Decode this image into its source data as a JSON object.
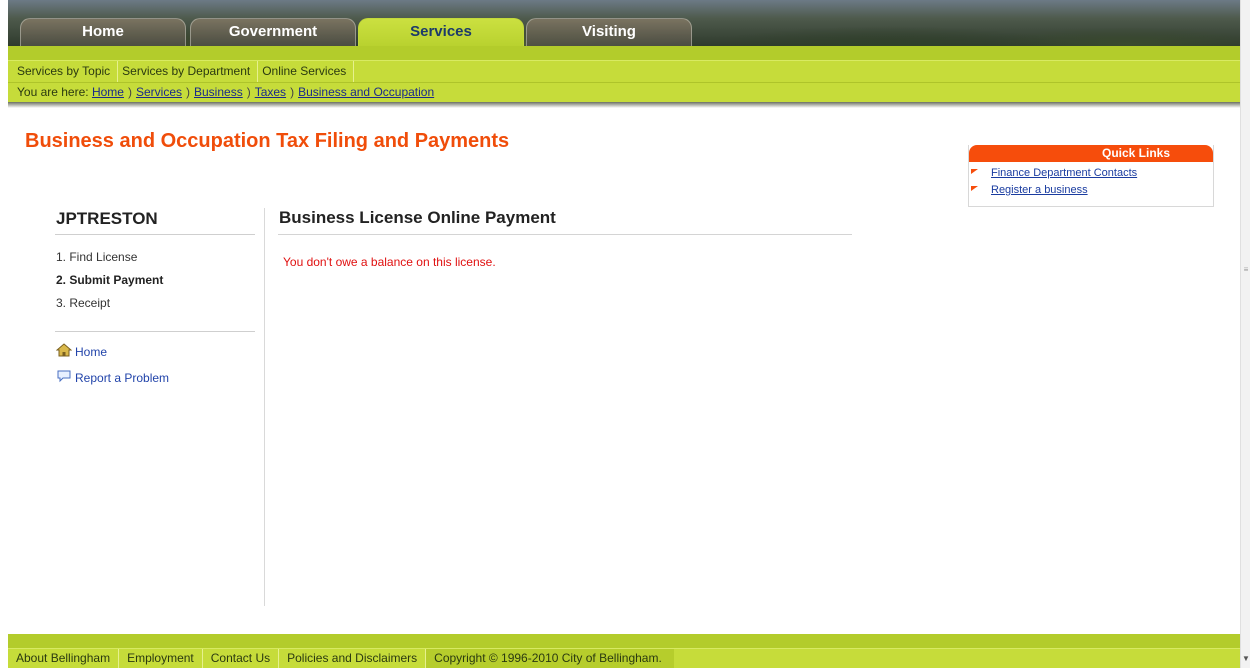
{
  "tabs": [
    {
      "label": "Home",
      "active": false
    },
    {
      "label": "Government",
      "active": false
    },
    {
      "label": "Services",
      "active": true
    },
    {
      "label": "Visiting",
      "active": false
    }
  ],
  "subnav": [
    "Services by Topic",
    "Services by Department",
    "Online Services"
  ],
  "breadcrumb": {
    "prefix": "You are here:",
    "separator": ")",
    "items": [
      "Home",
      "Services",
      "Business",
      "Taxes",
      "Business and Occupation"
    ]
  },
  "page_title": "Business and Occupation Tax Filing and Payments",
  "quick_links": {
    "title": "Quick Links",
    "items": [
      "Finance Department Contacts",
      "Register a business"
    ]
  },
  "sidebar": {
    "user": "JPTRESTON",
    "steps": [
      {
        "label": "1. Find License",
        "current": false
      },
      {
        "label": "2. Submit Payment",
        "current": true
      },
      {
        "label": "3. Receipt",
        "current": false
      }
    ],
    "links": [
      {
        "label": "Home",
        "icon": "house-icon"
      },
      {
        "label": "Report a Problem",
        "icon": "speech-bubble-icon"
      }
    ]
  },
  "main": {
    "title": "Business License Online Payment",
    "message": "You don't owe a balance on this license."
  },
  "footer": {
    "links": [
      "About Bellingham",
      "Employment",
      "Contact Us",
      "Policies and Disclaimers"
    ],
    "copyright": "Copyright © 1996-2010 City of Bellingham."
  },
  "colors": {
    "accent_green": "#c6dc3a",
    "title_orange": "#f04d0a",
    "quick_links_orange": "#f64d0c",
    "error_red": "#e01010"
  }
}
